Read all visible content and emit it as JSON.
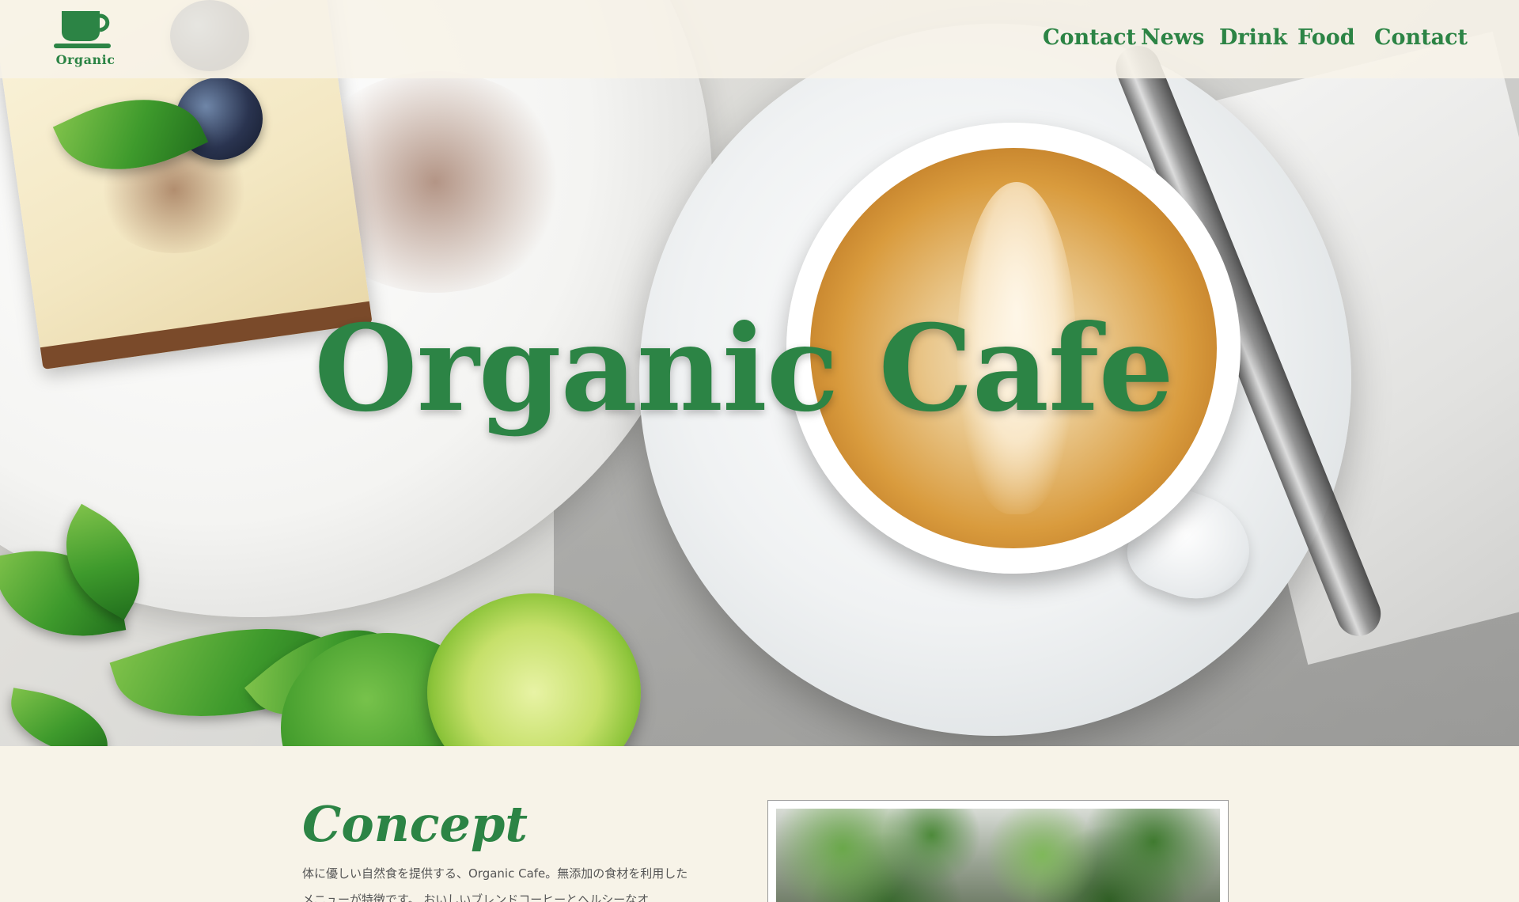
{
  "brand": {
    "logo_text": "Organic",
    "accent_color": "#2c8445",
    "background_color": "#f7f3e8"
  },
  "nav": {
    "items": [
      {
        "label": "Contact"
      },
      {
        "label": "News"
      },
      {
        "label": "Drink"
      },
      {
        "label": "Food"
      },
      {
        "label": "Contact"
      }
    ]
  },
  "hero": {
    "title": "Organic Cafe"
  },
  "concept": {
    "heading": "Concept",
    "text": "体に優しい自然食を提供する、Organic Cafe。無添加の食材を利用したメニューが特徴です。 おいしいブレンドコーヒーとヘルシーなオ"
  },
  "icons": {
    "logo": "coffee-cup-icon"
  }
}
